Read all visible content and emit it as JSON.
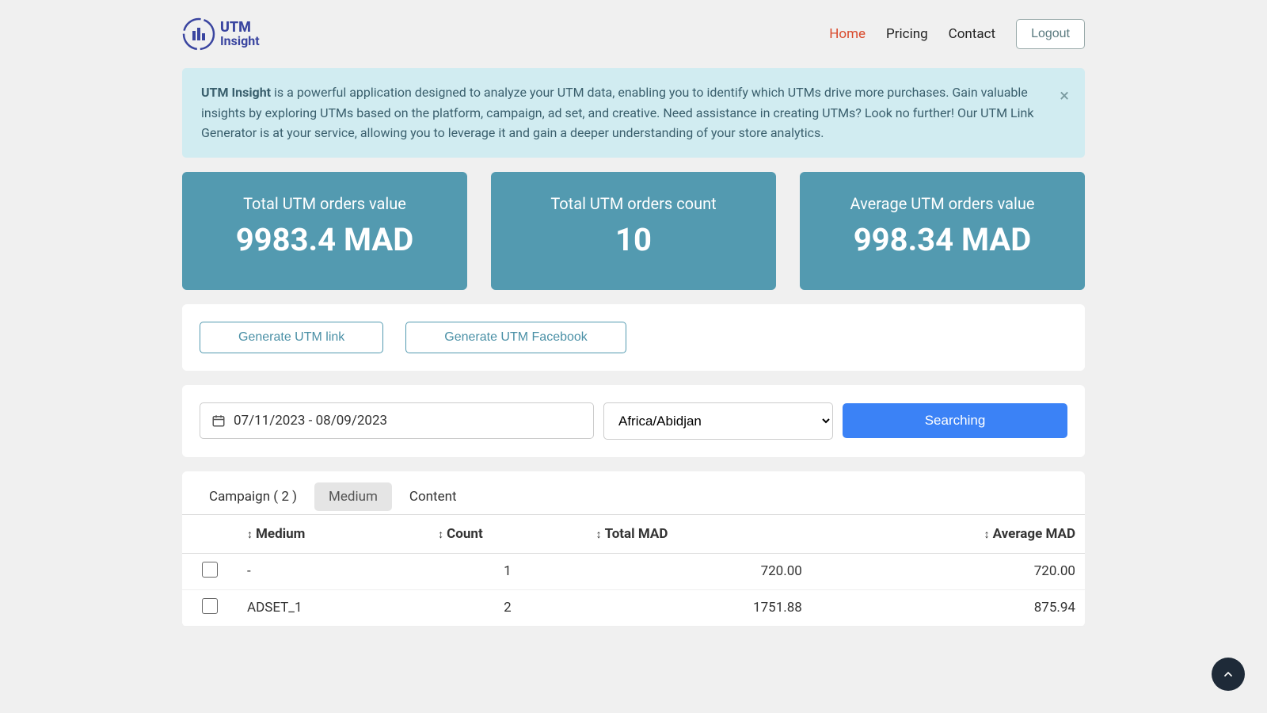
{
  "brand": {
    "line1": "UTM",
    "line2": "Insight"
  },
  "nav": {
    "home": "Home",
    "pricing": "Pricing",
    "contact": "Contact",
    "logout": "Logout"
  },
  "banner": {
    "bold": "UTM Insight",
    "text": " is a powerful application designed to analyze your UTM data, enabling you to identify which UTMs drive more purchases. Gain valuable insights by exploring UTMs based on the platform, campaign, ad set, and creative. Need assistance in creating UTMs? Look no further! Our UTM Link Generator is at your service, allowing you to leverage it and gain a deeper understanding of your store analytics."
  },
  "stats": {
    "total_value": {
      "title": "Total UTM orders value",
      "value": "9983.4 MAD"
    },
    "count": {
      "title": "Total UTM orders count",
      "value": "10"
    },
    "avg": {
      "title": "Average UTM orders value",
      "value": "998.34 MAD"
    }
  },
  "generate": {
    "link": "Generate UTM link",
    "facebook": "Generate UTM Facebook"
  },
  "filters": {
    "date_range": "07/11/2023 - 08/09/2023",
    "timezone": "Africa/Abidjan",
    "search": "Searching"
  },
  "tabs": {
    "campaign": "Campaign ( 2 )",
    "medium": "Medium",
    "content": "Content"
  },
  "table": {
    "headers": {
      "medium": "Medium",
      "count": "Count",
      "total": "Total MAD",
      "avg": "Average MAD"
    },
    "rows": [
      {
        "medium": "-",
        "count": "1",
        "total": "720.00",
        "avg": "720.00"
      },
      {
        "medium": "ADSET_1",
        "count": "2",
        "total": "1751.88",
        "avg": "875.94"
      }
    ]
  }
}
